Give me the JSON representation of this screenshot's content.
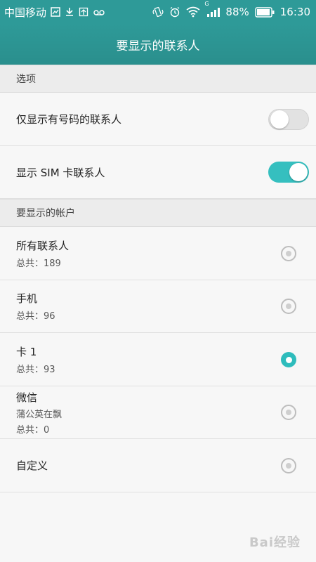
{
  "status_bar": {
    "carrier": "中国移动",
    "battery": "88%",
    "time": "16:30",
    "network_badge": "G"
  },
  "header": {
    "title": "要显示的联系人"
  },
  "options_section": {
    "header": "选项",
    "items": [
      {
        "label": "仅显示有号码的联系人",
        "enabled": false
      },
      {
        "label": "显示 SIM 卡联系人",
        "enabled": true
      }
    ]
  },
  "accounts_section": {
    "header": "要显示的帐户",
    "items": [
      {
        "name": "所有联系人",
        "count": "总共：189",
        "selected": false
      },
      {
        "name": "手机",
        "count": "总共：96",
        "selected": false
      },
      {
        "name": "卡 1",
        "count": "总共：93",
        "selected": true
      },
      {
        "name": "微信",
        "sub": "蒲公英在飘",
        "count": "总共：0",
        "selected": false
      },
      {
        "name": "自定义",
        "selected": false
      }
    ]
  },
  "watermark": "Bai经验",
  "colors": {
    "accent": "#35bfbf",
    "titlebar": "#2e9a98"
  }
}
